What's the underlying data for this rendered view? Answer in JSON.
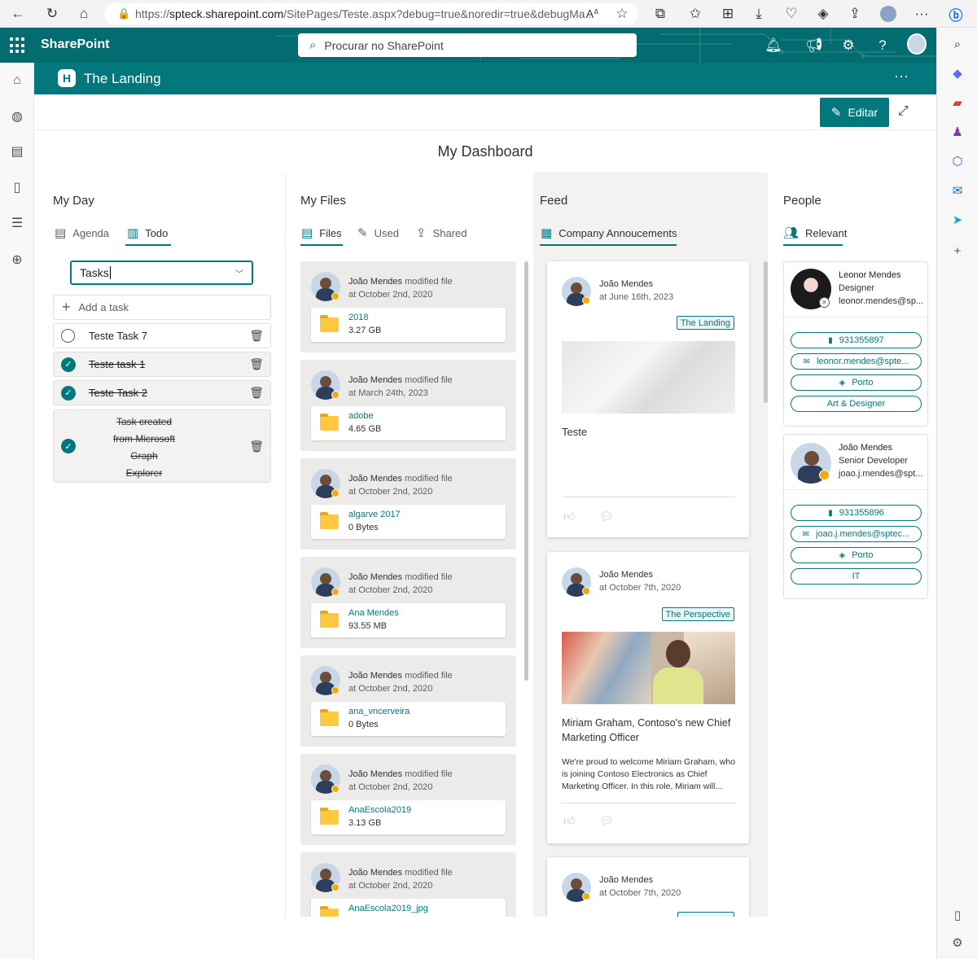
{
  "browser": {
    "url_prefix": "https://",
    "url_host": "spteck.sharepoint.com",
    "url_path": "/SitePages/Teste.aspx?debug=true&noredir=true&debugMa..."
  },
  "suite": {
    "brand": "SharePoint",
    "search_placeholder": "Procurar no SharePoint"
  },
  "site": {
    "logo_letter": "H",
    "title": "The Landing",
    "more": "···"
  },
  "command": {
    "edit_label": "Editar"
  },
  "dashboard": {
    "title": "My Dashboard"
  },
  "myday": {
    "title": "My Day",
    "tabs": [
      "Agenda",
      "Todo"
    ],
    "task_list": "Tasks",
    "add_task": "Add a task",
    "tasks": [
      {
        "label": "Teste Task 7",
        "done": false
      },
      {
        "label": "Teste task 1",
        "done": true
      },
      {
        "label": "Teste Task 2",
        "done": true
      },
      {
        "label_lines": [
          "Task created",
          "from Microsoft",
          "Graph",
          "Explorer"
        ],
        "done": true
      }
    ]
  },
  "myfiles": {
    "title": "My Files",
    "tabs": [
      "Files",
      "Used",
      "Shared"
    ],
    "action": "modified file",
    "items": [
      {
        "author": "João Mendes",
        "date": "at October 2nd, 2020",
        "name": "2018",
        "size": "3.27 GB"
      },
      {
        "author": "João Mendes",
        "date": "at March 24th, 2023",
        "name": "adobe",
        "size": "4.65 GB"
      },
      {
        "author": "João Mendes",
        "date": "at October 2nd, 2020",
        "name": "algarve 2017",
        "size": "0 Bytes"
      },
      {
        "author": "João Mendes",
        "date": "at October 2nd, 2020",
        "name": "Ana Mendes",
        "size": "93.55 MB"
      },
      {
        "author": "João Mendes",
        "date": "at October 2nd, 2020",
        "name": "ana_vncerveira",
        "size": "0 Bytes"
      },
      {
        "author": "João Mendes",
        "date": "at October 2nd, 2020",
        "name": "AnaEscola2019",
        "size": "3.13 GB"
      },
      {
        "author": "João Mendes",
        "date": "at October 2nd, 2020",
        "name": "AnaEscola2019_jpg",
        "size": ""
      }
    ]
  },
  "feed": {
    "title": "Feed",
    "tab": "Company Annoucements",
    "posts": [
      {
        "author": "João Mendes",
        "date": "at June 16th, 2023",
        "site": "The Landing",
        "title": "Teste",
        "body": ""
      },
      {
        "author": "João Mendes",
        "date": "at October 7th, 2020",
        "site": "The Perspective",
        "title": "Miriam Graham, Contoso's new Chief Marketing Officer",
        "body": "We're proud to welcome Miriam Graham, who is joining Contoso Electronics as Chief Marketing Officer. In this role, Miriam will..."
      },
      {
        "author": "João Mendes",
        "date": "at October 7th, 2020",
        "site": "",
        "title": "",
        "body": ""
      }
    ]
  },
  "people": {
    "title": "People",
    "tab": "Relevant",
    "persons": [
      {
        "name": "Leonor Mendes",
        "job": "Designer",
        "email_short": "leonor.mendes@sp...",
        "phone": "931355897",
        "email_btn": "leonor.mendes@spte...",
        "location": "Porto",
        "dept": "Art & Designer"
      },
      {
        "name": "João Mendes",
        "job": "Senior Developer",
        "email_short": "joao.j.mendes@spt...",
        "phone": "931355896",
        "email_btn": "joao.j.mendes@sptec...",
        "location": "Porto",
        "dept": "IT"
      }
    ]
  },
  "colors": {
    "teal": "#03787c",
    "suite": "#036c70",
    "presence": "#f8a80b",
    "folder": "#ffc83d"
  }
}
